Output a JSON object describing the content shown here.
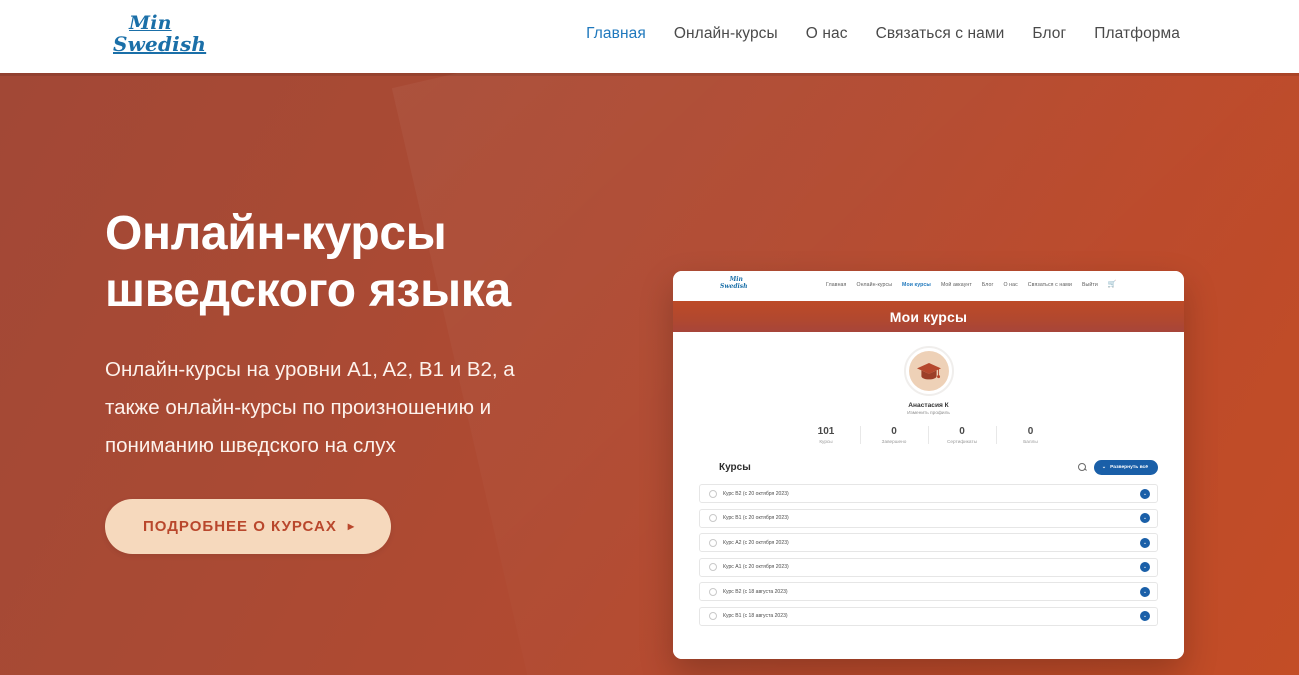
{
  "header": {
    "brand": {
      "line1": "Min",
      "line2": "Swedish"
    },
    "nav": [
      {
        "label": "Главная",
        "active": true
      },
      {
        "label": "Онлайн-курсы",
        "active": false
      },
      {
        "label": "О нас",
        "active": false
      },
      {
        "label": "Связаться с нами",
        "active": false
      },
      {
        "label": "Блог",
        "active": false
      },
      {
        "label": "Платформа",
        "active": false
      }
    ]
  },
  "hero": {
    "title_line1": "Онлайн-курсы",
    "title_line2": "шведского языка",
    "subtitle": "Онлайн-курсы на уровни A1, A2, B1 и B2, а также онлайн-курсы по произношению и пониманию шведского на слух",
    "cta_label": "ПОДРОБНЕЕ О КУРСАХ",
    "cta_arrow": "▸",
    "background_color": "#ac4a33",
    "background_color_end": "#c34d26"
  },
  "mockup": {
    "brand": {
      "line1": "Min",
      "line2": "Swedish"
    },
    "nav": [
      {
        "label": "Главная",
        "active": false
      },
      {
        "label": "Онлайн-курсы",
        "active": false
      },
      {
        "label": "Мои курсы",
        "active": true
      },
      {
        "label": "Мой аккаунт",
        "active": false
      },
      {
        "label": "Блог",
        "active": false
      },
      {
        "label": "О нас",
        "active": false
      },
      {
        "label": "Связаться с нами",
        "active": false
      },
      {
        "label": "Выйти",
        "active": false
      }
    ],
    "cart_icon": "cart-icon",
    "band_title": "Мои курсы",
    "profile": {
      "avatar_icon": "graduation-cap-icon",
      "name": "Анастасия К",
      "edit_link": "Изменить профиль"
    },
    "stats": [
      {
        "value": "101",
        "label": "Курсы"
      },
      {
        "value": "0",
        "label": "Завершено"
      },
      {
        "value": "0",
        "label": "Сертификаты"
      },
      {
        "value": "0",
        "label": "Баллы"
      }
    ],
    "courses_section": {
      "title": "Курсы",
      "search_icon": "search-icon",
      "expand_label": "Развернуть всё",
      "expand_chevron": "⌄",
      "accent_color": "#1a5fa8"
    },
    "courses": [
      {
        "label": "Курс B2 (с 20 октября 2023)"
      },
      {
        "label": "Курс B1 (с 20 октября 2023)"
      },
      {
        "label": "Курс A2 (с 20 октября 2023)"
      },
      {
        "label": "Курс A1 (с 20 октября 2023)"
      },
      {
        "label": "Курс B2 (с 18 августа 2023)"
      },
      {
        "label": "Курс B1 (с 18 августа 2023)"
      }
    ],
    "row_toggle_chevron": "⌄"
  }
}
